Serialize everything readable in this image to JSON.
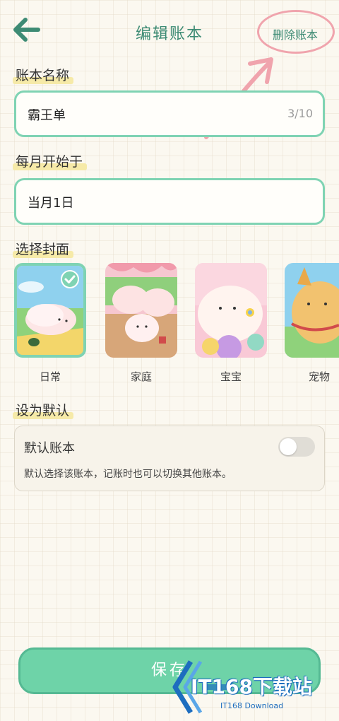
{
  "header": {
    "title": "编辑账本",
    "delete_label": "删除账本"
  },
  "book_name": {
    "label": "账本名称",
    "value": "霸王单",
    "counter": "3/10"
  },
  "month_start": {
    "label": "每月开始于",
    "value": "当月1日"
  },
  "cover": {
    "label": "选择封面",
    "items": [
      {
        "name": "日常",
        "selected": true
      },
      {
        "name": "家庭",
        "selected": false
      },
      {
        "name": "宝宝",
        "selected": false
      },
      {
        "name": "宠物",
        "selected": false
      }
    ]
  },
  "default_section": {
    "label": "设为默认",
    "card_title": "默认账本",
    "card_desc": "默认选择该账本，记账时也可以切换其他账本。",
    "toggle_on": false
  },
  "save_label": "保存",
  "watermark": {
    "text": "IT168下载站",
    "sub": "IT168 Download"
  },
  "colors": {
    "accent": "#7fd3b3",
    "title": "#3d8b74",
    "save": "#6ed3a8",
    "annotation": "#f0a4ad"
  }
}
